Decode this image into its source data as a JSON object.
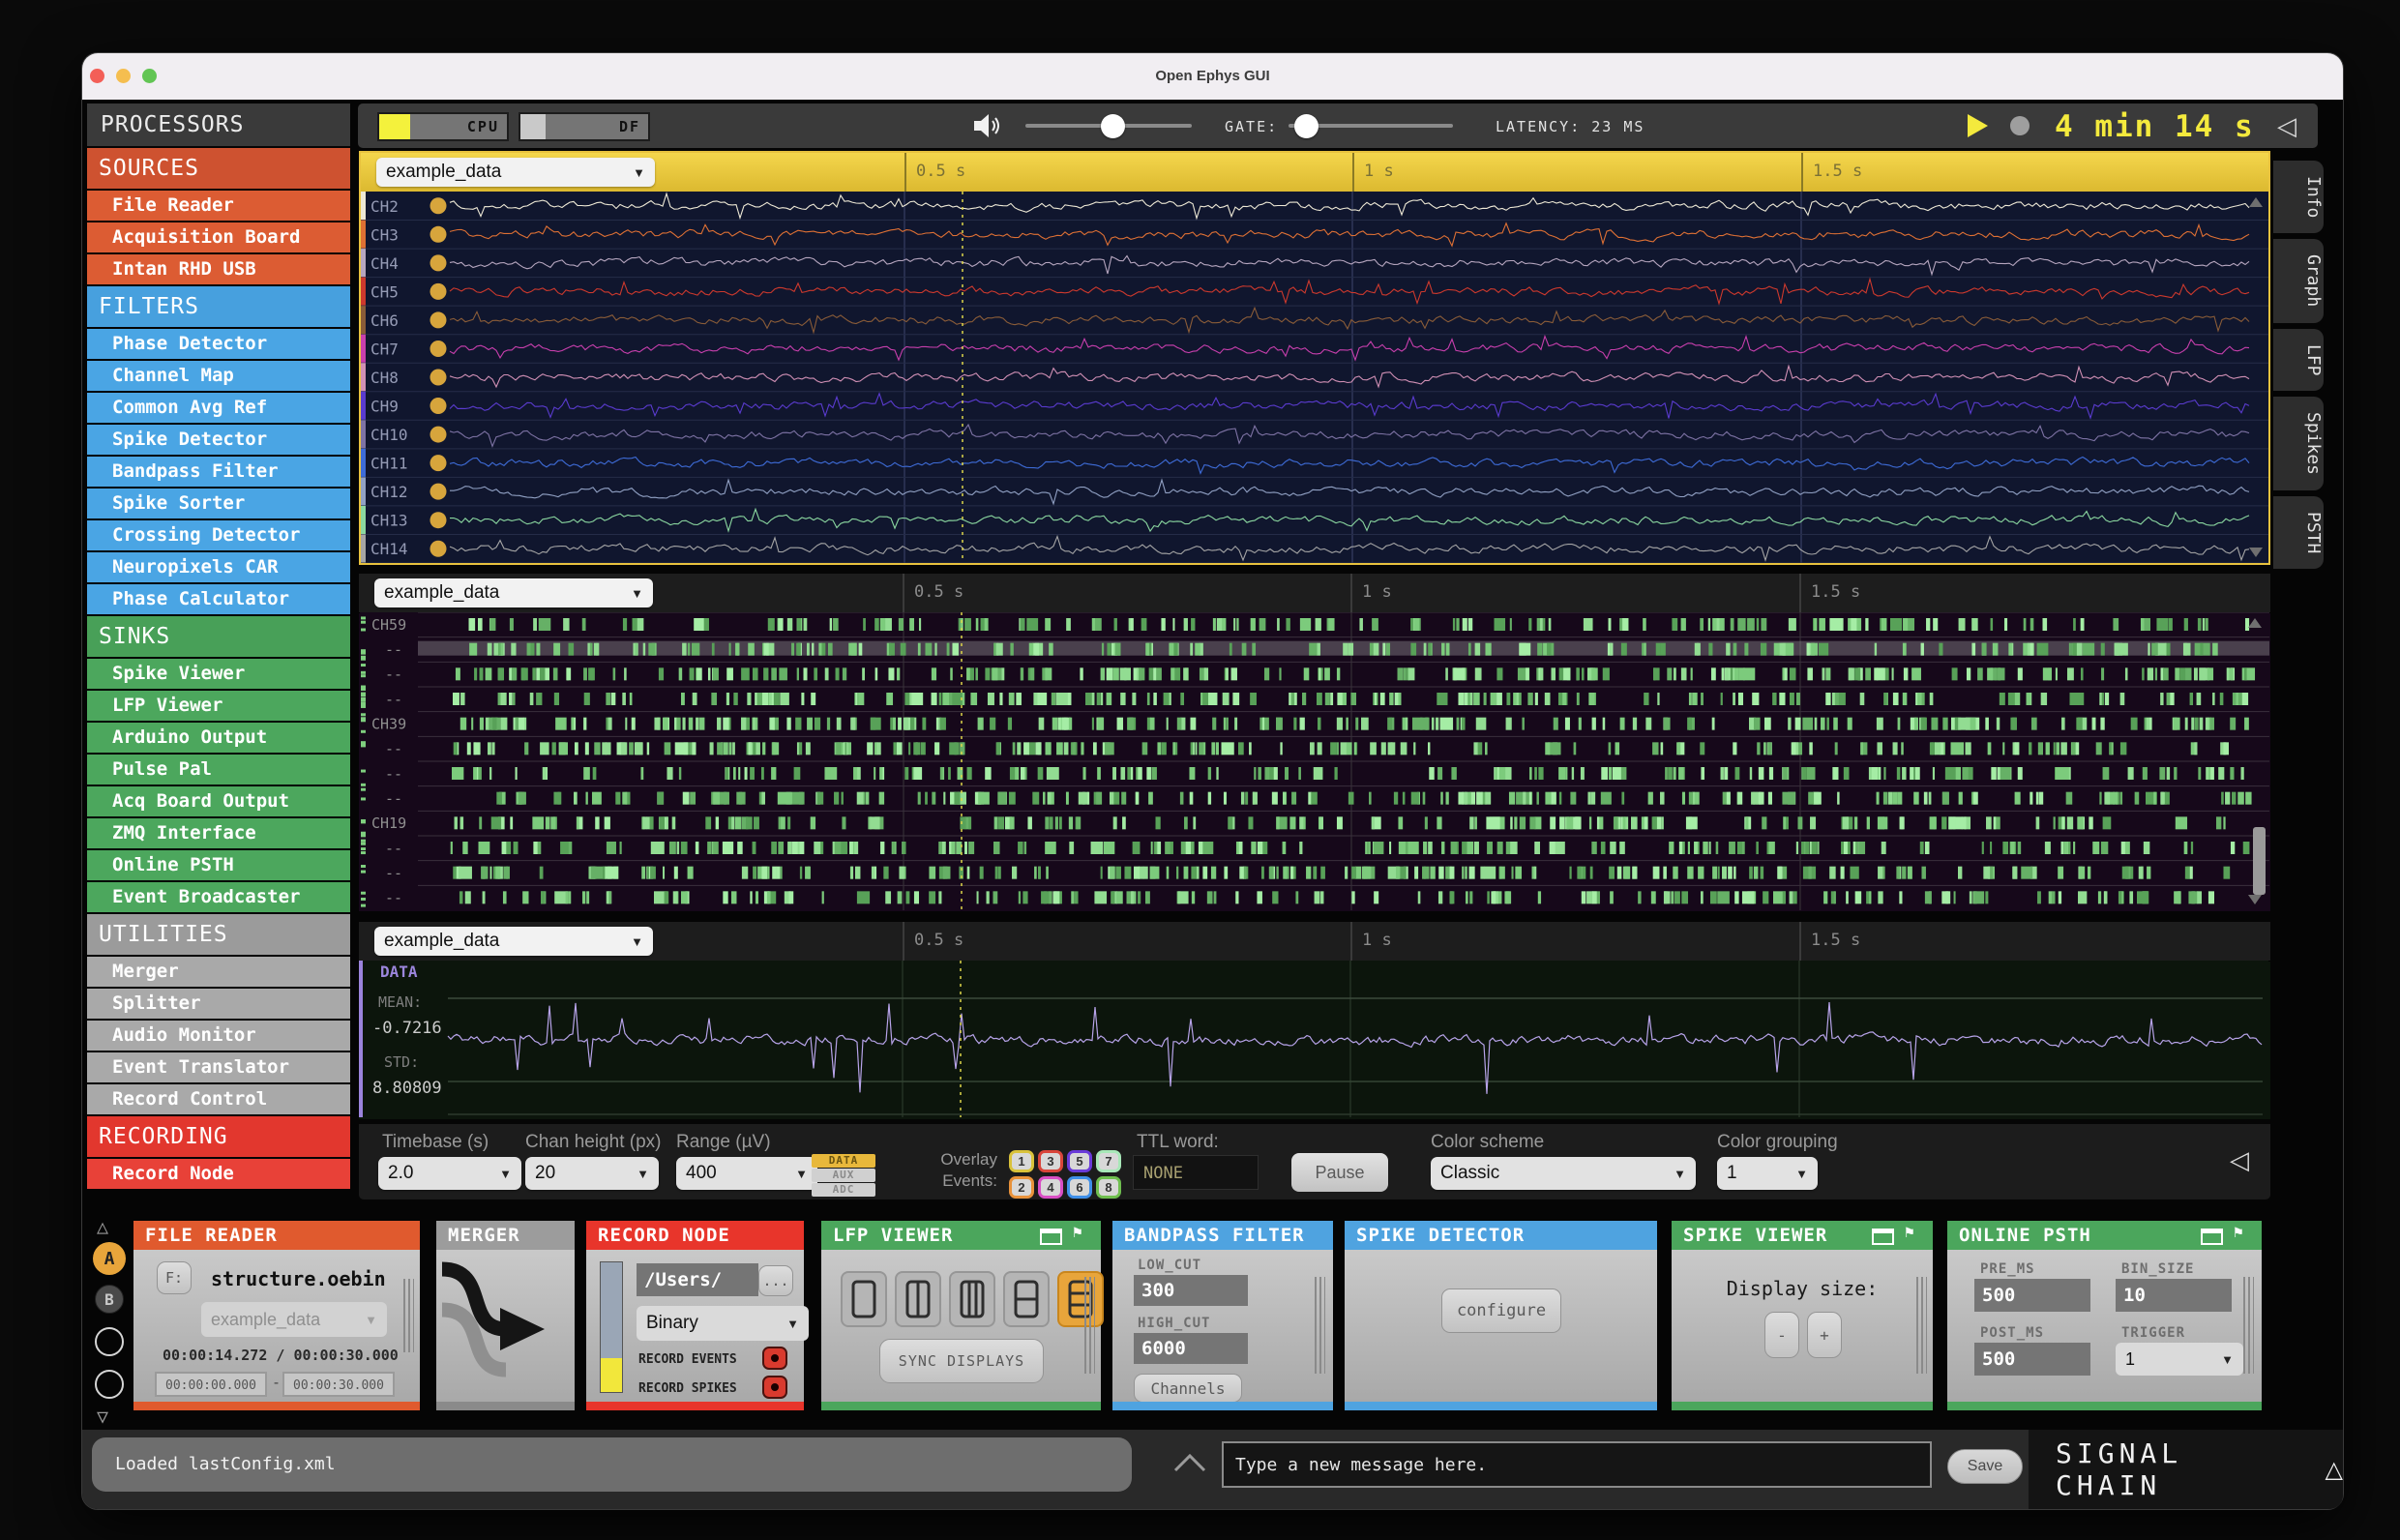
{
  "window": {
    "title": "Open Ephys GUI"
  },
  "icons": {
    "dropdown_arrow": "▼",
    "collapse_left": "◁",
    "chevron_up": "︿",
    "triangle_up": "△",
    "triangle_down": "▽",
    "warning_triangle": "△",
    "speaker": "speaker-icon",
    "play": "play-icon",
    "record": "record-circle-icon",
    "popout": "popout-window-icon",
    "pin": "⚑",
    "ellipsis": "..."
  },
  "sidebar": {
    "title": "PROCESSORS",
    "sections": [
      {
        "label": "SOURCES",
        "color": "#CE5230",
        "item_color": "#DC5C33",
        "items": [
          "File Reader",
          "Acquisition Board",
          "Intan RHD USB"
        ]
      },
      {
        "label": "FILTERS",
        "color": "#47A0DE",
        "item_color": "#4AA5E4",
        "items": [
          "Phase Detector",
          "Channel Map",
          "Common Avg Ref",
          "Spike Detector",
          "Bandpass Filter",
          "Spike Sorter",
          "Crossing Detector",
          "Neuropixels CAR",
          "Phase Calculator"
        ]
      },
      {
        "label": "SINKS",
        "color": "#48A058",
        "item_color": "#4CA75D",
        "items": [
          "Spike Viewer",
          "LFP Viewer",
          "Arduino Output",
          "Pulse Pal",
          "Acq Board Output",
          "ZMQ Interface",
          "Online PSTH",
          "Event Broadcaster"
        ]
      },
      {
        "label": "UTILITIES",
        "color": "#9B9B9B",
        "item_color": "#A9A9A9",
        "items": [
          "Merger",
          "Splitter",
          "Audio Monitor",
          "Event Translator",
          "Record Control"
        ]
      },
      {
        "label": "RECORDING",
        "color": "#E2372E",
        "item_color": "#E84138",
        "items": [
          "Record Node"
        ]
      }
    ]
  },
  "topbar": {
    "cpu_label": "CPU",
    "cpu_pct": 24,
    "df_label": "DF",
    "df_pct": 20,
    "gate_label": "GATE:",
    "latency": "LATENCY: 23 MS",
    "clock": "4 min 14 s"
  },
  "panels": [
    {
      "source": "example_data",
      "ticks": [
        "0.5 s",
        "1 s",
        "1.5 s"
      ],
      "channels": [
        {
          "label": "CH2",
          "color": "#EDE8D5"
        },
        {
          "label": "CH3",
          "color": "#DE7034"
        },
        {
          "label": "CH4",
          "color": "#B6A6BF"
        },
        {
          "label": "CH5",
          "color": "#CD392D"
        },
        {
          "label": "CH6",
          "color": "#8A5C38"
        },
        {
          "label": "CH7",
          "color": "#C83FAD"
        },
        {
          "label": "CH8",
          "color": "#D190B5"
        },
        {
          "label": "CH9",
          "color": "#5A3BCF"
        },
        {
          "label": "CH10",
          "color": "#7E73A5"
        },
        {
          "label": "CH11",
          "color": "#3E6CD8"
        },
        {
          "label": "CH12",
          "color": "#91A1C4"
        },
        {
          "label": "CH13",
          "color": "#8BD8A0"
        },
        {
          "label": "CH14",
          "color": "#A5A5A5"
        }
      ]
    },
    {
      "source": "example_data",
      "ticks": [
        "0.5 s",
        "1 s",
        "1.5 s"
      ],
      "row_labels": [
        "CH59",
        "--",
        "--",
        "--",
        "CH39",
        "--",
        "--",
        "--",
        "CH19",
        "--",
        "--",
        "--"
      ]
    },
    {
      "source": "example_data",
      "ticks": [
        "0.5 s",
        "1 s",
        "1.5 s"
      ],
      "data_label": "DATA",
      "mean_label": "MEAN:",
      "mean": "-0.7216",
      "std_label": "STD:",
      "std": "8.80809"
    }
  ],
  "options": {
    "timebase_label": "Timebase (s)",
    "timebase": "2.0",
    "chan_height_label": "Chan height (px)",
    "chan_height": "20",
    "range_label": "Range (µV)",
    "range": "400",
    "signal_buttons": [
      "DATA",
      "AUX",
      "ADC"
    ],
    "overlay_label_1": "Overlay",
    "overlay_label_2": "Events:",
    "events": [
      {
        "n": "1",
        "color": "#D9C23B"
      },
      {
        "n": "2",
        "color": "#E8923B"
      },
      {
        "n": "3",
        "color": "#D9453B"
      },
      {
        "n": "4",
        "color": "#D94FC4"
      },
      {
        "n": "5",
        "color": "#6A3BD9"
      },
      {
        "n": "6",
        "color": "#3F8FE8"
      },
      {
        "n": "7",
        "color": "#A8E8B8"
      },
      {
        "n": "8",
        "color": "#6FBF4F"
      }
    ],
    "ttl_label": "TTL word:",
    "ttl_value": "NONE",
    "pause": "Pause",
    "color_scheme_label": "Color scheme",
    "color_scheme": "Classic",
    "color_grouping_label": "Color grouping",
    "color_grouping": "1"
  },
  "side_tabs": [
    "Info",
    "Graph",
    "LFP",
    "Spikes",
    "PSTH"
  ],
  "chain": {
    "selector_a": "A",
    "selector_b": "B",
    "file_reader": {
      "title": "FILE READER",
      "f_button": "F:",
      "filename": "structure.oebin",
      "dataset": "example_data",
      "time": "00:00:14.272 / 00:00:30.000",
      "range_start": "00:00:00.000",
      "range_sep": "-",
      "range_end": "00:00:30.000"
    },
    "merger": {
      "title": "MERGER"
    },
    "record_node": {
      "title": "RECORD NODE",
      "path": "/Users/",
      "browse": "...",
      "format": "Binary",
      "record_events": "RECORD EVENTS",
      "record_spikes": "RECORD SPIKES"
    },
    "lfp_viewer": {
      "title": "LFP VIEWER",
      "sync": "SYNC DISPLAYS"
    },
    "bandpass_filter": {
      "title": "BANDPASS FILTER",
      "low_label": "LOW_CUT",
      "low": "300",
      "high_label": "HIGH_CUT",
      "high": "6000",
      "channels": "Channels"
    },
    "spike_detector": {
      "title": "SPIKE DETECTOR",
      "configure": "configure"
    },
    "spike_viewer": {
      "title": "SPIKE VIEWER",
      "display_size": "Display size:",
      "minus": "-",
      "plus": "+"
    },
    "online_psth": {
      "title": "ONLINE PSTH",
      "pre_label": "PRE_MS",
      "pre": "500",
      "bin_label": "BIN_SIZE",
      "bin": "10",
      "post_label": "POST_MS",
      "post": "500",
      "trigger_label": "TRIGGER",
      "trigger": "1"
    }
  },
  "statusbar": {
    "message": "Loaded lastConfig.xml",
    "input_placeholder": "Type a new message here.",
    "save": "Save",
    "signal_chain": "SIGNAL CHAIN"
  }
}
